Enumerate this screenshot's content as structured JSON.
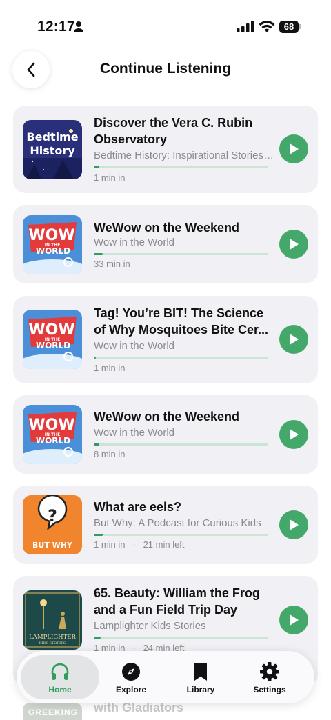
{
  "status_bar": {
    "time": "12:17",
    "battery": "68"
  },
  "header": {
    "title": "Continue Listening"
  },
  "colors": {
    "accent": "#45a86b",
    "progress_fill": "#2f9d5c",
    "progress_track": "#c9e5d6",
    "card_bg": "#f1f1f5"
  },
  "episodes": [
    {
      "title": "Discover the Vera C. Rubin Observatory",
      "show": "Bedtime History: Inspirational Stories for Kids",
      "elapsed": "1 min in",
      "remaining": "",
      "progress": 0.03,
      "artwork": "bedtime-history-artwork",
      "artwork_text": [
        "Bedtime",
        "History"
      ]
    },
    {
      "title": "WeWow on the Weekend",
      "show": "Wow in the World",
      "elapsed": "33 min in",
      "remaining": "",
      "progress": 0.05,
      "artwork": "wow-in-the-world-artwork",
      "artwork_text": [
        "WOW",
        "IN THE",
        "WORLD"
      ]
    },
    {
      "title": "Tag! You’re BIT! The Science of Why Mosquitoes Bite Cer...",
      "show": "Wow in the World",
      "elapsed": "1 min in",
      "remaining": "",
      "progress": 0.01,
      "artwork": "wow-in-the-world-artwork",
      "artwork_text": [
        "WOW",
        "IN THE",
        "WORLD"
      ]
    },
    {
      "title": "WeWow on the Weekend",
      "show": "Wow in the World",
      "elapsed": "8 min in",
      "remaining": "",
      "progress": 0.03,
      "artwork": "wow-in-the-world-artwork",
      "artwork_text": [
        "WOW",
        "IN THE",
        "WORLD"
      ]
    },
    {
      "title": "What are eels?",
      "show": "But Why: A Podcast for Curious Kids",
      "elapsed": "1 min in",
      "remaining": "21 min left",
      "progress": 0.05,
      "artwork": "but-why-artwork",
      "artwork_text": [
        "BUT WHY"
      ]
    },
    {
      "title": "65. Beauty: William the Frog and a Fun Field Trip Day",
      "show": "Lamplighter Kids Stories",
      "elapsed": "1 min in",
      "remaining": "24 min left",
      "progress": 0.04,
      "artwork": "lamplighter-artwork",
      "artwork_text": [
        "LAMPLIGHTER",
        "KIDS STORIES"
      ]
    }
  ],
  "peek": {
    "title": "with Gladiators",
    "artwork_text": "GREEKING"
  },
  "tabs": [
    {
      "label": "Home",
      "icon": "headphones-icon",
      "active": true
    },
    {
      "label": "Explore",
      "icon": "compass-icon",
      "active": false
    },
    {
      "label": "Library",
      "icon": "bookmark-icon",
      "active": false
    },
    {
      "label": "Settings",
      "icon": "gear-icon",
      "active": false
    }
  ]
}
